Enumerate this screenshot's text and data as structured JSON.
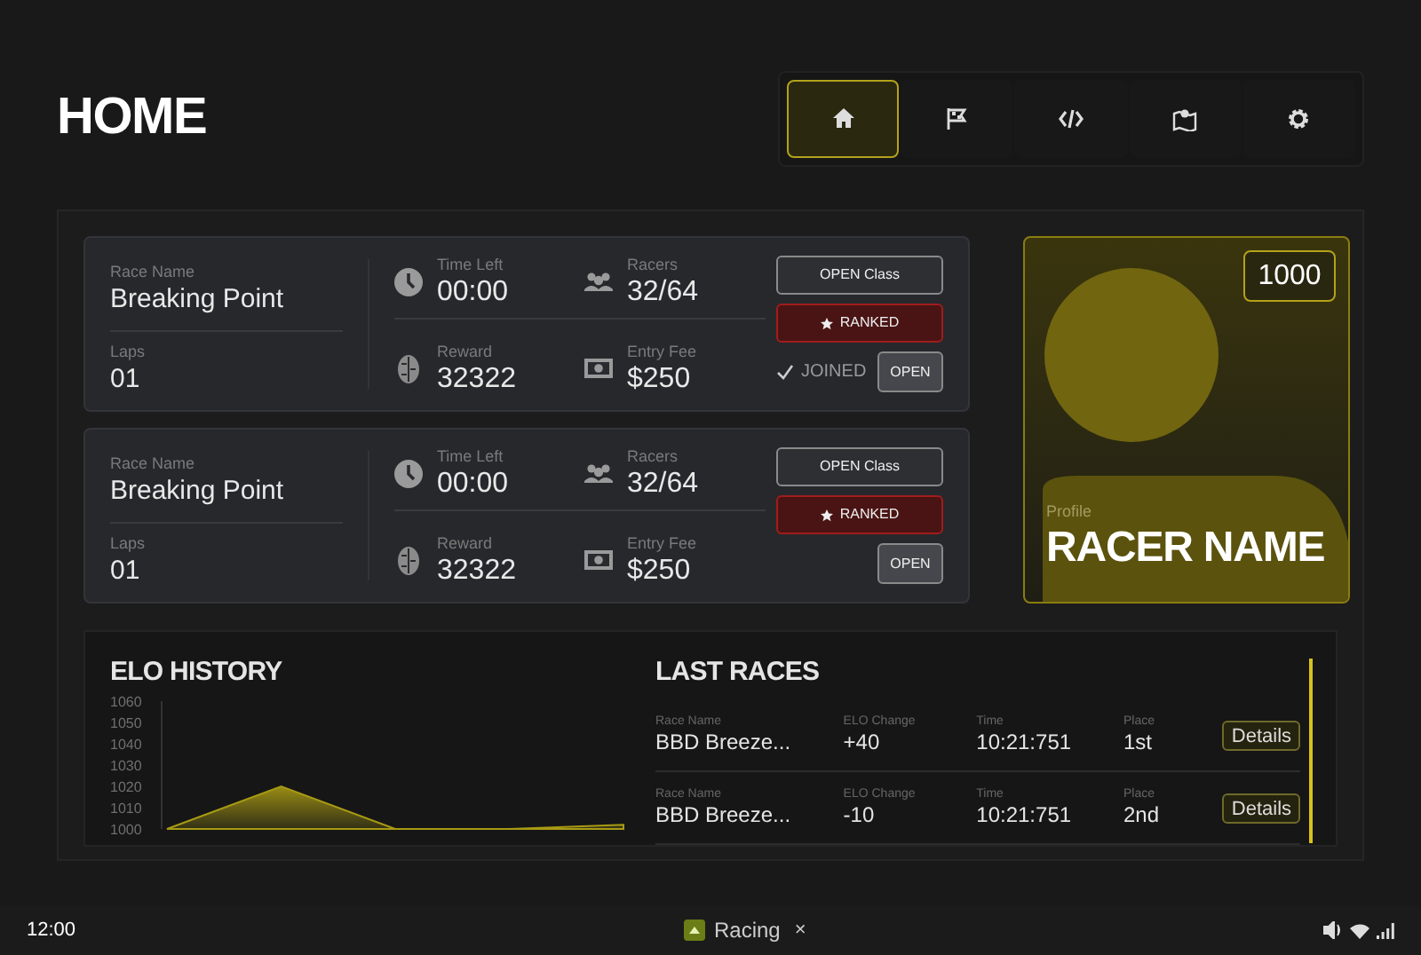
{
  "header": {
    "title": "HOME"
  },
  "nav": [
    {
      "selected": true
    },
    {
      "selected": false
    },
    {
      "selected": false
    },
    {
      "selected": false
    },
    {
      "selected": false
    }
  ],
  "races": [
    {
      "name_label": "Race Name",
      "name": "Breaking Point",
      "laps_label": "Laps",
      "laps": "01",
      "time_label": "Time Left",
      "time": "00:00",
      "racers_label": "Racers",
      "racers": "32/64",
      "reward_label": "Reward",
      "reward": "32322",
      "fee_label": "Entry Fee",
      "fee": "$250",
      "class_button": "OPEN Class",
      "ranked": true,
      "ranked_label": "RANKED",
      "joined": true,
      "joined_label": "JOINED",
      "open_button": "OPEN"
    },
    {
      "name_label": "Race Name",
      "name": "Breaking Point",
      "laps_label": "Laps",
      "laps": "01",
      "time_label": "Time Left",
      "time": "00:00",
      "racers_label": "Racers",
      "racers": "32/64",
      "reward_label": "Reward",
      "reward": "32322",
      "fee_label": "Entry Fee",
      "fee": "$250",
      "class_button": "OPEN Class",
      "ranked": true,
      "ranked_label": "RANKED",
      "joined": false,
      "open_button": "OPEN"
    }
  ],
  "profile": {
    "elo": "1000",
    "label": "Profile",
    "name": "RACER NAME"
  },
  "elo_history": {
    "title": "ELO HISTORY",
    "chart_data": {
      "type": "area",
      "ylim": [
        1000,
        1060
      ],
      "yticks": [
        1000,
        1010,
        1020,
        1030,
        1040,
        1050,
        1060
      ],
      "series": [
        {
          "color": "#a89a14",
          "values": [
            1000,
            1020,
            1000,
            1000,
            1002
          ]
        }
      ]
    }
  },
  "last_races": {
    "title": "LAST RACES",
    "rows": [
      {
        "name_label": "Race Name",
        "name": "BBD Breeze...",
        "elo_label": "ELO Change",
        "elo": "+40",
        "time_label": "Time",
        "time": "10:21:751",
        "place_label": "Place",
        "place": "1st",
        "button": "Details"
      },
      {
        "name_label": "Race Name",
        "name": "BBD Breeze...",
        "elo_label": "ELO Change",
        "elo": "-10",
        "time_label": "Time",
        "time": "10:21:751",
        "place_label": "Place",
        "place": "2nd",
        "button": "Details"
      }
    ]
  },
  "taskbar": {
    "clock": "12:00",
    "app": "Racing",
    "close": "×"
  }
}
